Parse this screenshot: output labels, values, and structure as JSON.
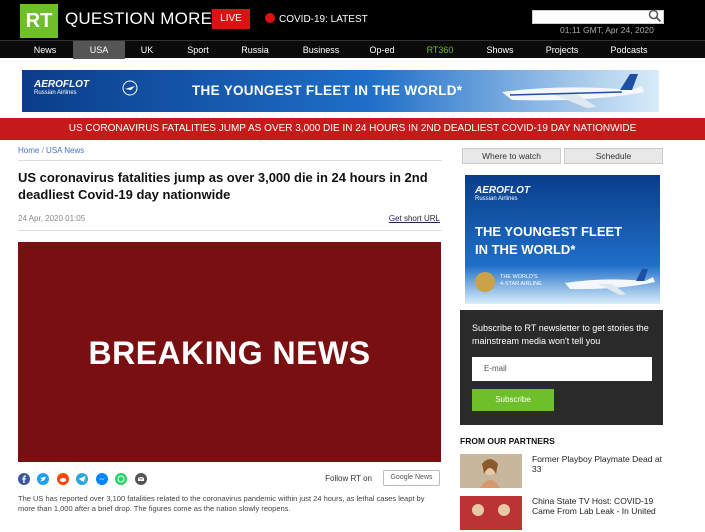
{
  "header": {
    "logo": "RT",
    "slogan": "QUESTION MORE",
    "live_label": "LIVE",
    "covid_label": "COVID-19: LATEST",
    "search_placeholder": "",
    "datetime": "01:11 GMT, Apr 24, 2020"
  },
  "nav": {
    "items": [
      "News",
      "USA",
      "UK",
      "Sport",
      "Russia",
      "Business",
      "Op-ed",
      "RT360",
      "Shows",
      "Projects",
      "Podcasts"
    ],
    "active": "USA"
  },
  "ad_banner": {
    "brand": "AEROFLOT",
    "brand_sub": "Russian Airlines",
    "title": "THE YOUNGEST FLEET IN THE WORLD*"
  },
  "headline_bar": "US CORONAVIRUS FATALITIES JUMP AS OVER 3,000 DIE IN 24 HOURS IN 2ND DEADLIEST COVID-19 DAY NATIONWIDE",
  "article": {
    "breadcrumb": [
      "Home",
      "USA News"
    ],
    "title": "US coronavirus fatalities jump as over 3,000 die in 24 hours in 2nd deadliest Covid-19 day nationwide",
    "date": "24 Apr, 2020 01:05",
    "short_url_label": "Get short URL",
    "hero_text": "BREAKING NEWS",
    "follow_label": "Follow RT on",
    "google_news_label": "Google News",
    "summary": "The US has reported over 3,100 fatalities related to the coronavirus pandemic within just 24 hours, as lethal cases leapt by more than 1,000 after a brief drop. The figures come as the nation slowly reopens."
  },
  "share_icons": [
    "facebook-icon",
    "twitter-icon",
    "reddit-icon",
    "telegram-icon",
    "messenger-icon",
    "whatsapp-icon",
    "email-icon"
  ],
  "sidebar": {
    "tabs": [
      "Where to watch",
      "Schedule"
    ],
    "ad": {
      "brand": "AEROFLOT",
      "brand_sub": "Russian Airlines",
      "title_line1": "THE YOUNGEST FLEET",
      "title_line2": "IN THE WORLD*",
      "small_line1": "THE WORLD'S",
      "small_line2": "4-STAR AIRLINE"
    },
    "newsletter": {
      "text": "Subscribe to RT newsletter to get stories the mainstream media won't tell you",
      "input_placeholder": "E-mail",
      "button_label": "Subscribe"
    },
    "partners_title": "FROM OUR PARTNERS",
    "partners": [
      {
        "title": "Former Playboy Playmate Dead at 33"
      },
      {
        "title": "China State TV Host: COVID-19 Came From Lab Leak - In United"
      }
    ]
  },
  "colors": {
    "brand_green": "#6fbf2a",
    "headline_red": "#c51a1a",
    "hero_maroon": "#7a0f12",
    "link_blue": "#4a6fbf"
  }
}
